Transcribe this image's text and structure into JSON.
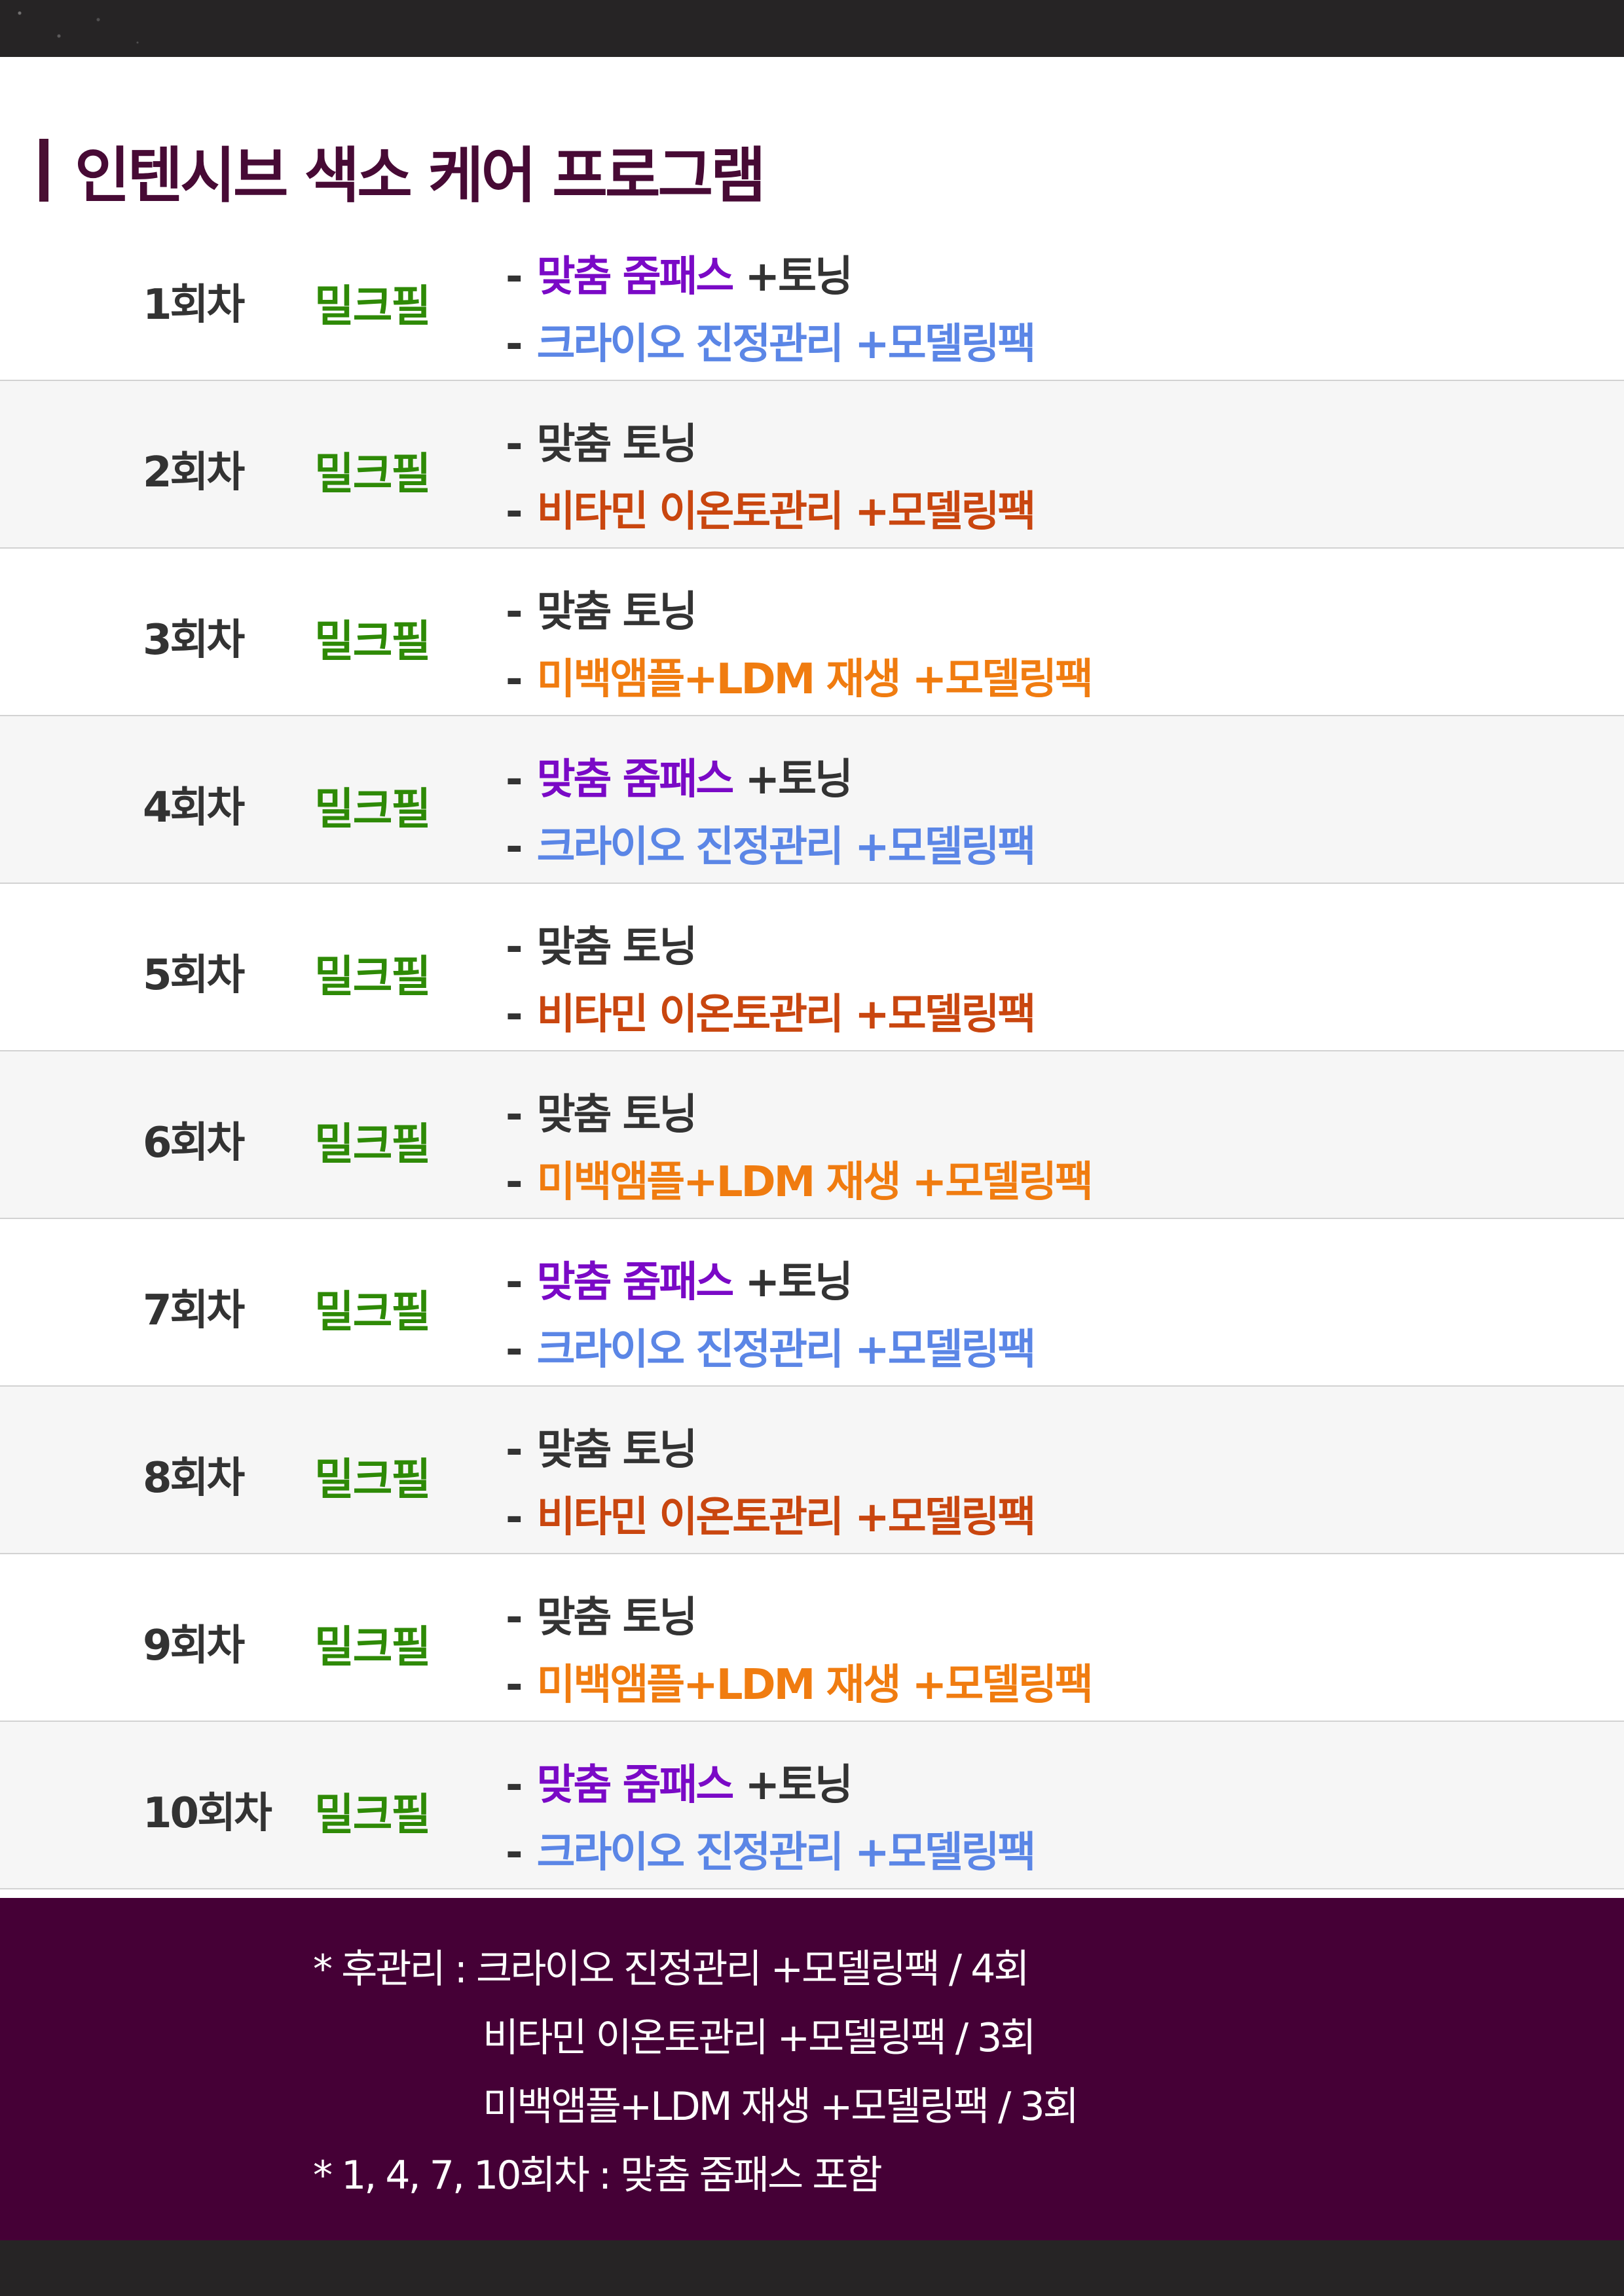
{
  "heading": "인텐시브 색소 케어 프로그램",
  "dash": "-",
  "sessions": [
    {
      "no": "1회차",
      "peel": "밀크필",
      "a": [
        {
          "t": "맞춤 줌패스",
          "c": "purple"
        },
        {
          "t": " +토닝",
          "c": "dark"
        }
      ],
      "b": [
        {
          "t": "크라이오 진정관리 +모델링팩",
          "c": "blue"
        }
      ]
    },
    {
      "no": "2회차",
      "peel": "밀크필",
      "a": [
        {
          "t": "맞춤 토닝",
          "c": "dark"
        }
      ],
      "b": [
        {
          "t": "비타민 이온토관리 +모델링팩",
          "c": "red"
        }
      ]
    },
    {
      "no": "3회차",
      "peel": "밀크필",
      "a": [
        {
          "t": "맞춤 토닝",
          "c": "dark"
        }
      ],
      "b": [
        {
          "t": "미백앰플+LDM 재생 +모델링팩",
          "c": "orange"
        }
      ]
    },
    {
      "no": "4회차",
      "peel": "밀크필",
      "a": [
        {
          "t": "맞춤 줌패스",
          "c": "purple"
        },
        {
          "t": " +토닝",
          "c": "dark"
        }
      ],
      "b": [
        {
          "t": "크라이오 진정관리 +모델링팩",
          "c": "blue"
        }
      ]
    },
    {
      "no": "5회차",
      "peel": "밀크필",
      "a": [
        {
          "t": "맞춤 토닝",
          "c": "dark"
        }
      ],
      "b": [
        {
          "t": "비타민 이온토관리 +모델링팩",
          "c": "red"
        }
      ]
    },
    {
      "no": "6회차",
      "peel": "밀크필",
      "a": [
        {
          "t": "맞춤 토닝",
          "c": "dark"
        }
      ],
      "b": [
        {
          "t": "미백앰플+LDM 재생 +모델링팩",
          "c": "orange"
        }
      ]
    },
    {
      "no": "7회차",
      "peel": "밀크필",
      "a": [
        {
          "t": "맞춤 줌패스",
          "c": "purple"
        },
        {
          "t": " +토닝",
          "c": "dark"
        }
      ],
      "b": [
        {
          "t": "크라이오 진정관리 +모델링팩",
          "c": "blue"
        }
      ]
    },
    {
      "no": "8회차",
      "peel": "밀크필",
      "a": [
        {
          "t": "맞춤 토닝",
          "c": "dark"
        }
      ],
      "b": [
        {
          "t": "비타민 이온토관리 +모델링팩",
          "c": "red"
        }
      ]
    },
    {
      "no": "9회차",
      "peel": "밀크필",
      "a": [
        {
          "t": "맞춤 토닝",
          "c": "dark"
        }
      ],
      "b": [
        {
          "t": "미백앰플+LDM 재생 +모델링팩",
          "c": "orange"
        }
      ]
    },
    {
      "no": "10회차",
      "peel": "밀크필",
      "a": [
        {
          "t": "맞춤 줌패스",
          "c": "purple"
        },
        {
          "t": " +토닝",
          "c": "dark"
        }
      ],
      "b": [
        {
          "t": "크라이오 진정관리 +모델링팩",
          "c": "blue"
        }
      ]
    }
  ],
  "notes": {
    "line1": "* 후관리 : 크라이오 진정관리 +모델링팩 / 4회",
    "line2": "비타민 이온토관리 +모델링팩 / 3회",
    "line3": "미백앰플+LDM 재생 +모델링팩 / 3회",
    "line4": "* 1, 4, 7, 10회차 : 맞춤 줌패스 포함"
  },
  "colors": {
    "heading": "#470a35",
    "peel": "#2e8a06",
    "purple": "#7a09c6",
    "blue": "#5b86e6",
    "red": "#c9460f",
    "orange": "#f07c10",
    "notes_bg": "#450036"
  }
}
